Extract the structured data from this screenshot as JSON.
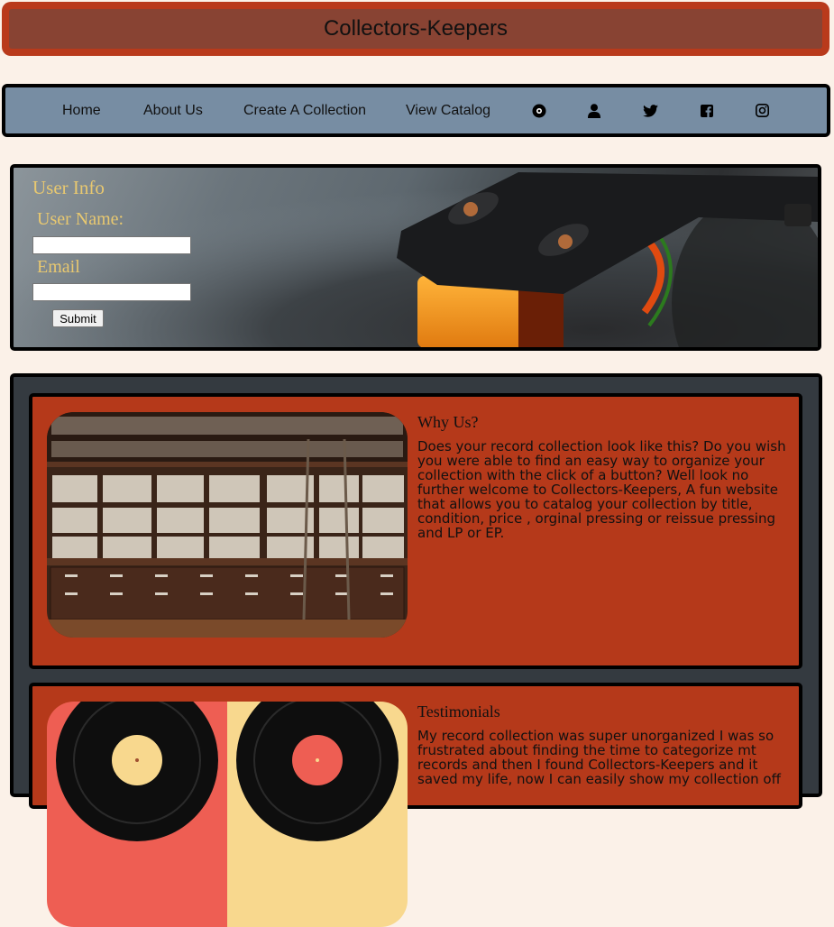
{
  "header": {
    "title": "Collectors-Keepers"
  },
  "nav": {
    "items": [
      "Home",
      "About Us",
      "Create A Collection",
      "View Catalog"
    ],
    "icons": [
      "disc-icon",
      "user-icon",
      "twitter-icon",
      "facebook-icon",
      "instagram-icon"
    ]
  },
  "user_info": {
    "title": "User Info",
    "username_label": "User Name:",
    "username_value": "",
    "email_label": "Email",
    "email_value": "",
    "submit_label": "Submit"
  },
  "cards": [
    {
      "title": "Why Us?",
      "text": "Does your record collection look like this? Do you wish you were able to find an easy way to organize your collection with the click of a button? Well look no further welcome to Collectors-Keepers, A fun website that allows you to catalog your collection by title, condition, price , orginal pressing or reissue pressing and LP or EP."
    },
    {
      "title": "Testimonials",
      "text": "My record collection was super unorganized I was so frustrated about finding the time to categorize mt records and then I found Collectors-Keepers and it saved my life, now I can easily show my collection off"
    }
  ],
  "colors": {
    "background": "#fbf1e8",
    "header_border": "#b93a1b",
    "header_fill": "#884333",
    "nav_fill": "#778da3",
    "label_gold": "#e8c870",
    "content_dark": "#343a40",
    "card_red": "#b5391a"
  }
}
